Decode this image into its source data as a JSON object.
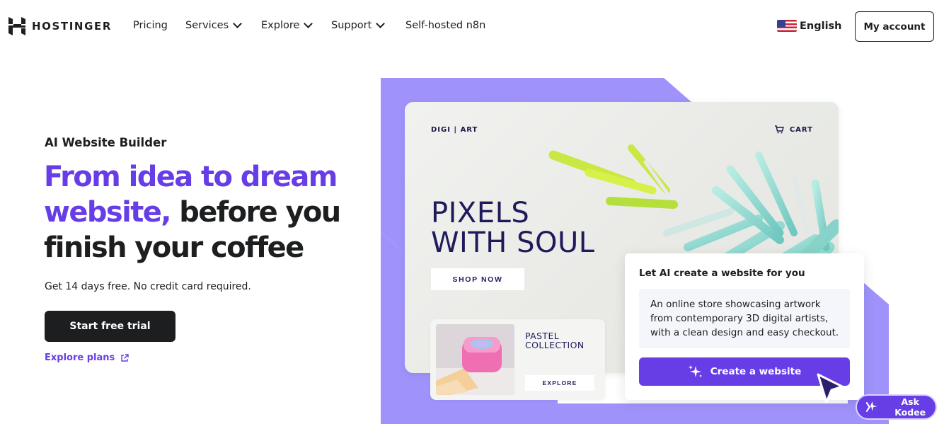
{
  "nav": {
    "brand": "HOSTINGER",
    "links": [
      {
        "label": "Pricing"
      },
      {
        "label": "Services"
      },
      {
        "label": "Explore"
      },
      {
        "label": "Support"
      },
      {
        "label": "Self-hosted n8n"
      }
    ],
    "language": "English",
    "account_label": "My account"
  },
  "hero": {
    "eyebrow": "AI Website Builder",
    "headline_accent": "From idea to dream website,",
    "headline_rest": " before you finish your coffee",
    "subtext": "Get 14 days free. No credit card required.",
    "cta_label": "Start free trial",
    "plans_link": "Explore plans"
  },
  "mockup": {
    "brand": "DIGI | ART",
    "cart": "CART",
    "title_line1": "PIXELS",
    "title_line2": "WITH SOUL",
    "shop_label": "SHOP NOW",
    "product_name": "PASTEL COLLECTION",
    "product_button": "EXPLORE"
  },
  "ai_card": {
    "title": "Let AI create a website for you",
    "prompt": "An online store showcasing artwork from contemporary 3D digital artists, with a clean design and easy checkout.",
    "button_label": "Create a website"
  },
  "assistant": {
    "label": "Ask Kodee"
  },
  "colors": {
    "accent": "#673de6",
    "shape": "#9f93fb",
    "dark": "#1d1e20"
  },
  "icons": [
    "hostinger-logo-icon",
    "chevron-down-icon",
    "us-flag-icon",
    "external-link-icon",
    "cart-icon",
    "sparkle-icon",
    "cursor-icon",
    "kodee-icon"
  ]
}
